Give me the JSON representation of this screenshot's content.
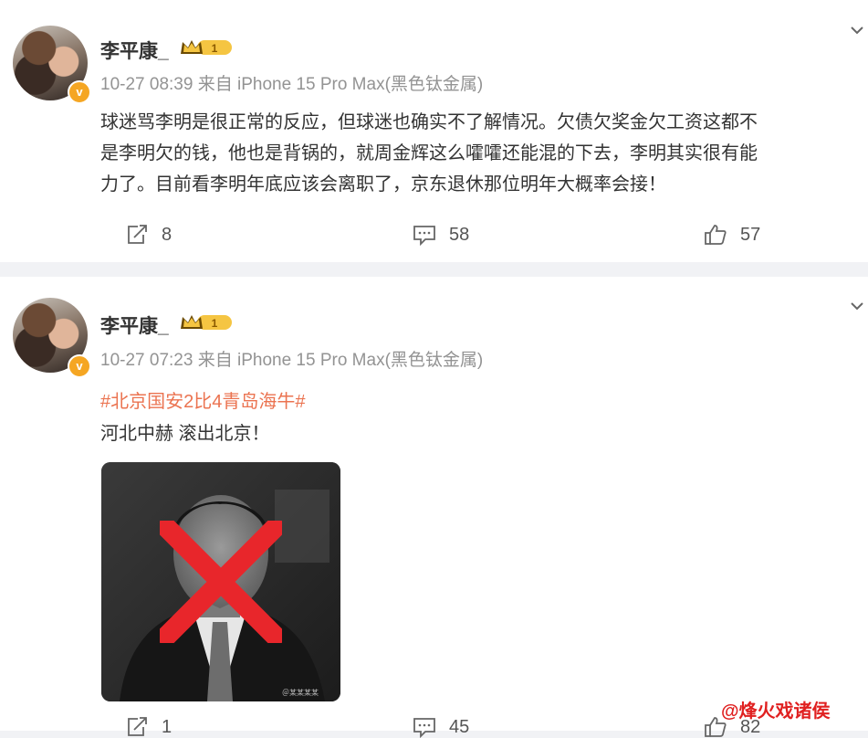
{
  "posts": [
    {
      "username": "李平康_",
      "vip_level": "1",
      "verified_badge": "v",
      "meta": "10-27 08:39 来自 iPhone 15 Pro Max(黑色钛金属)",
      "content_lines": [
        "球迷骂李明是很正常的反应，但球迷也确实不了解情况。欠债欠奖金欠工资这都不",
        "是李明欠的钱，他也是背锅的，就周金辉这么嚯嚯还能混的下去，李明其实很有能",
        "力了。目前看李明年底应该会离职了，京东退休那位明年大概率会接！"
      ],
      "shares": "8",
      "comments": "58",
      "likes": "57"
    },
    {
      "username": "李平康_",
      "vip_level": "1",
      "verified_badge": "v",
      "meta": "10-27 07:23 来自 iPhone 15 Pro Max(黑色钛金属)",
      "topic": "#北京国安2比4青岛海牛#",
      "content": "河北中赫 滚出北京！",
      "image_watermark": "＠某某某某",
      "shares": "1",
      "comments": "45",
      "likes": "82"
    }
  ],
  "watermark": "@烽火戏诸侯",
  "colors": {
    "topic": "#eb7350",
    "vip_gold": "#f5a623",
    "cross": "#e8262b",
    "meta": "#939393"
  },
  "icons": [
    "share-icon",
    "comment-icon",
    "like-icon",
    "more-chevron-icon",
    "vip-crown-icon"
  ]
}
